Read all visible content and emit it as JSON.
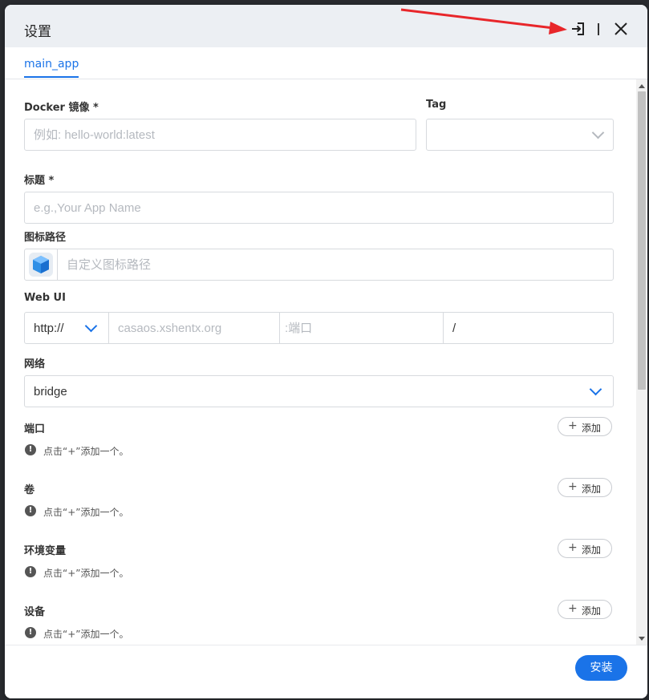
{
  "dialog": {
    "title": "设置",
    "import_icon": "import-icon",
    "close_icon": "close-icon"
  },
  "tabs": [
    {
      "label": "main_app",
      "active": true
    }
  ],
  "form": {
    "image": {
      "label": "Docker 镜像 *",
      "placeholder": "例如: hello-world:latest",
      "value": ""
    },
    "tag": {
      "label": "Tag",
      "value": ""
    },
    "title": {
      "label": "标题 *",
      "placeholder": "e.g.,Your App Name",
      "value": ""
    },
    "icon_path": {
      "label": "图标路径",
      "placeholder": "自定义图标路径",
      "icon": "app-cube-icon"
    },
    "webui": {
      "label": "Web UI",
      "scheme": "http://",
      "host_placeholder": "casaos.xshentx.org",
      "port_placeholder": ":端口",
      "path_value": "/"
    },
    "network": {
      "label": "网络",
      "value": "bridge"
    },
    "sections": [
      {
        "label": "端口",
        "add_label": "添加",
        "hint": "点击“+”添加一个。"
      },
      {
        "label": "卷",
        "add_label": "添加",
        "hint": "点击“+”添加一个。"
      },
      {
        "label": "环境变量",
        "add_label": "添加",
        "hint": "点击“+”添加一个。"
      },
      {
        "label": "设备",
        "add_label": "添加",
        "hint": "点击“+”添加一个。"
      }
    ]
  },
  "footer": {
    "install_label": "安装"
  },
  "colors": {
    "accent": "#1a73e8",
    "annotation_arrow": "#e8262a",
    "header_bg": "#eceff3"
  }
}
